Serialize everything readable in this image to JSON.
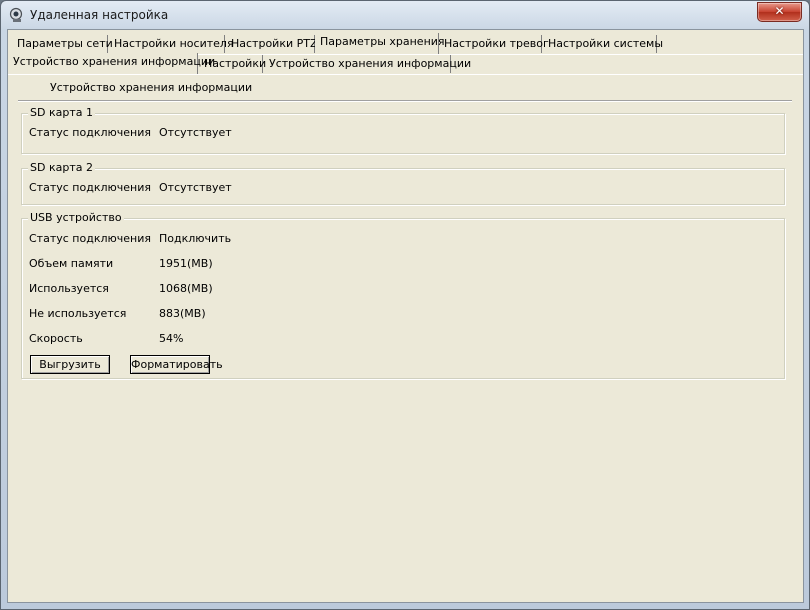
{
  "window": {
    "title": "Удаленная настройка"
  },
  "main_tabs": [
    "Параметры сети",
    "Настройки носителя",
    "Настройки PTZ",
    "Параметры хранения",
    "Настройки тревог",
    "Настройки системы"
  ],
  "sub_tabs": [
    "Устройство хранения информации",
    "Настройки",
    "Устройство хранения информации"
  ],
  "section_header": "Устройство хранения информации",
  "sd1": {
    "title": "SD карта 1",
    "status_label": "Статус подключения",
    "status_value": "Отсутствует"
  },
  "sd2": {
    "title": "SD карта 2",
    "status_label": "Статус подключения",
    "status_value": "Отсутствует"
  },
  "usb": {
    "title": "USB устройство",
    "rows": [
      {
        "label": "Статус подключения",
        "value": "Подключить"
      },
      {
        "label": "Объем памяти",
        "value": "1951(MB)"
      },
      {
        "label": "Используется",
        "value": "1068(MB)"
      },
      {
        "label": "Не используется",
        "value": "883(MB)"
      },
      {
        "label": "Скорость",
        "value": "54%"
      }
    ],
    "unload_button": "Выгрузить",
    "format_button": "Форматировать"
  },
  "colors": {
    "close_button": "#c7412f",
    "panel_bg": "#ece9d8"
  },
  "icons": {
    "app": "camera-icon",
    "close": "close-icon"
  }
}
